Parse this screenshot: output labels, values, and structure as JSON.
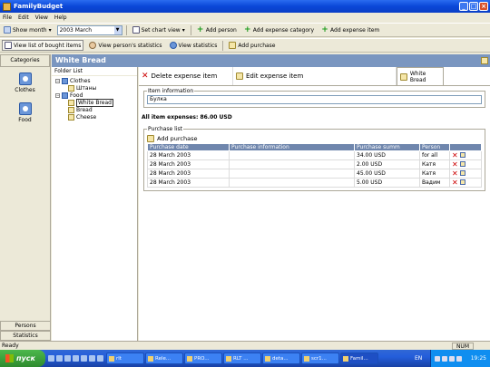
{
  "window": {
    "title": "FamilyBudget"
  },
  "menu": [
    "File",
    "Edit",
    "View",
    "Help"
  ],
  "toolbar1": {
    "show_month": "Show month",
    "month_value": "2003 March",
    "set_chart_view": "Set chart view",
    "add_person": "Add person",
    "add_expense_category": "Add expense category",
    "add_expense_item": "Add expense item"
  },
  "toolbar2": {
    "view_bought_items": "View list of bought items",
    "view_person_statistics": "View person's statistics",
    "view_statistics": "View statistics",
    "add_purchase": "Add purchase"
  },
  "left_panel": {
    "header": "Categories",
    "categories": [
      "Clothes",
      "Food"
    ],
    "bottom_tabs": [
      "Persons",
      "Statistics"
    ]
  },
  "main_header": "White Bread",
  "tree": {
    "title": "Folder List",
    "nodes": [
      {
        "label": "Clothes",
        "level": 0
      },
      {
        "label": "Штаны",
        "level": 1
      },
      {
        "label": "Food",
        "level": 0
      },
      {
        "label": "White Bread",
        "level": 1
      },
      {
        "label": "Bread",
        "level": 1
      },
      {
        "label": "Cheese",
        "level": 1
      }
    ]
  },
  "actions": {
    "delete": "Delete expense item",
    "edit": "Edit expense item",
    "current": "White Bread"
  },
  "item_info": {
    "legend": "Item information",
    "value": "Булка"
  },
  "all_expenses": "All item expenses:  86.00 USD",
  "purchase_list": {
    "legend": "Purchase list",
    "add_label": "Add purchase",
    "columns": [
      "Purchase date",
      "Purchase information",
      "Purchase summ",
      "Person"
    ],
    "rows": [
      {
        "date": "28 March 2003",
        "info": "",
        "summ": "34.00 USD",
        "person": "for all"
      },
      {
        "date": "28 March 2003",
        "info": "",
        "summ": "2.00 USD",
        "person": "Катя"
      },
      {
        "date": "28 March 2003",
        "info": "",
        "summ": "45.00 USD",
        "person": "Катя"
      },
      {
        "date": "28 March 2003",
        "info": "",
        "summ": "5.00 USD",
        "person": "Вадим"
      }
    ]
  },
  "status": {
    "text": "Ready",
    "num": "NUM"
  },
  "taskbar": {
    "start": "пуск",
    "tasks": [
      "rlt",
      "Rele...",
      "PRO...",
      "RLT ...",
      "deta...",
      "scr1...",
      "Famil..."
    ],
    "lang": "EN",
    "clock": "19:25"
  }
}
